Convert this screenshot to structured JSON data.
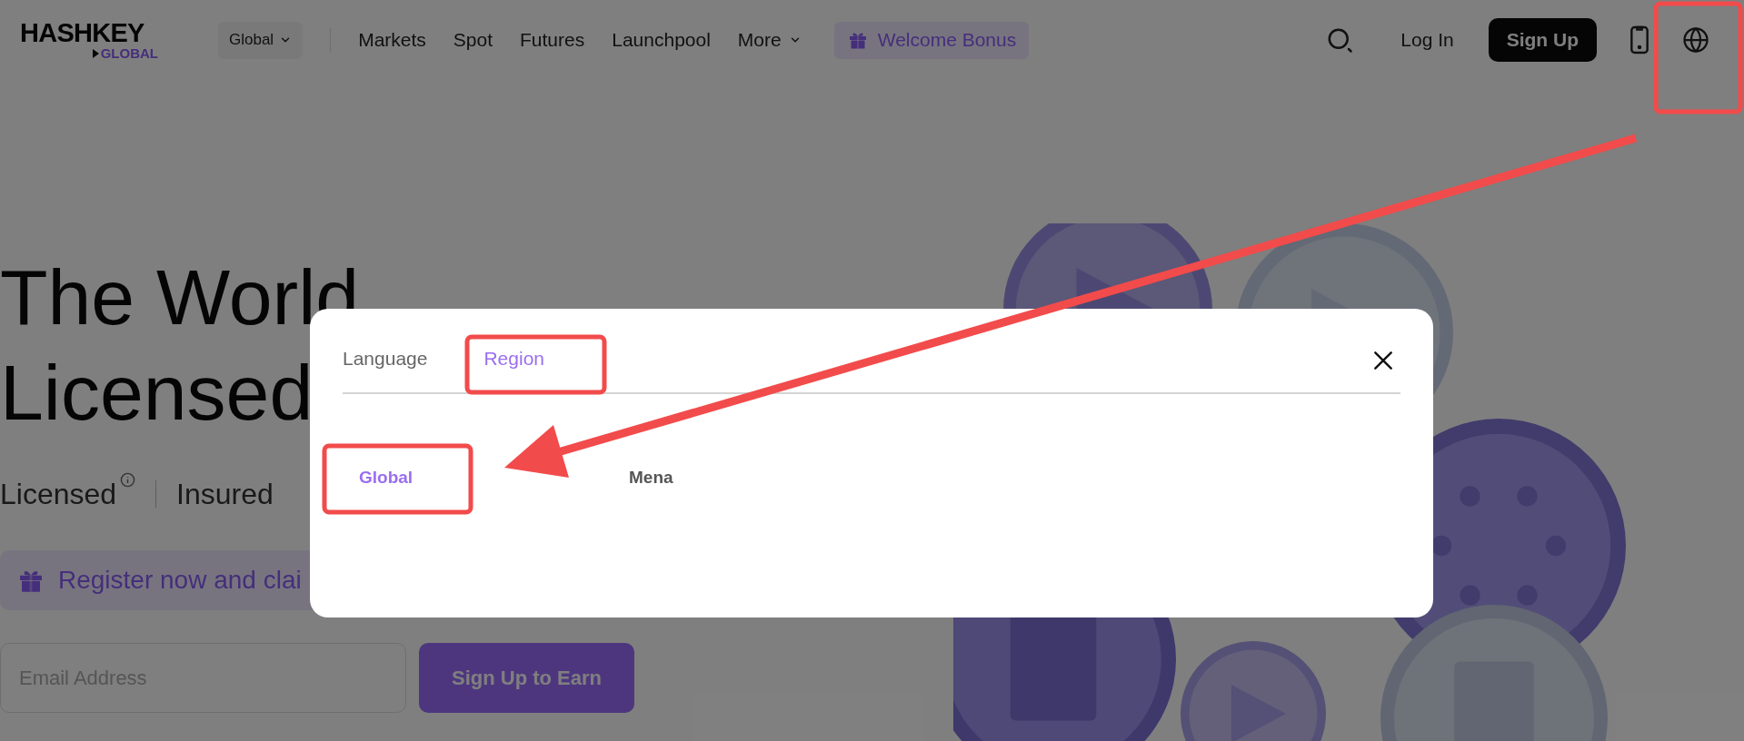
{
  "header": {
    "logo": {
      "name": "HASHKEY",
      "sub": "GLOBAL"
    },
    "region_selector": "Global",
    "nav": [
      {
        "label": "Markets",
        "dropdown": false
      },
      {
        "label": "Spot",
        "dropdown": false
      },
      {
        "label": "Futures",
        "dropdown": false
      },
      {
        "label": "Launchpool",
        "dropdown": false
      },
      {
        "label": "More",
        "dropdown": true
      }
    ],
    "promo": "Welcome Bonus",
    "login": "Log In",
    "signup": "Sign Up"
  },
  "hero": {
    "title_lines": [
      "The World",
      "Licensed"
    ],
    "features": [
      {
        "label": "Licensed",
        "info": true
      },
      {
        "label": "Insured",
        "info": false
      }
    ],
    "promo_banner": "Register now and clai",
    "email": {
      "placeholder": "Email Address"
    },
    "cta": "Sign Up to Earn"
  },
  "dialog": {
    "tabs": [
      {
        "label": "Language",
        "selected": false
      },
      {
        "label": "Region",
        "selected": true
      }
    ],
    "options": [
      {
        "label": "Global",
        "selected": true
      },
      {
        "label": "Mena",
        "selected": false
      }
    ]
  }
}
